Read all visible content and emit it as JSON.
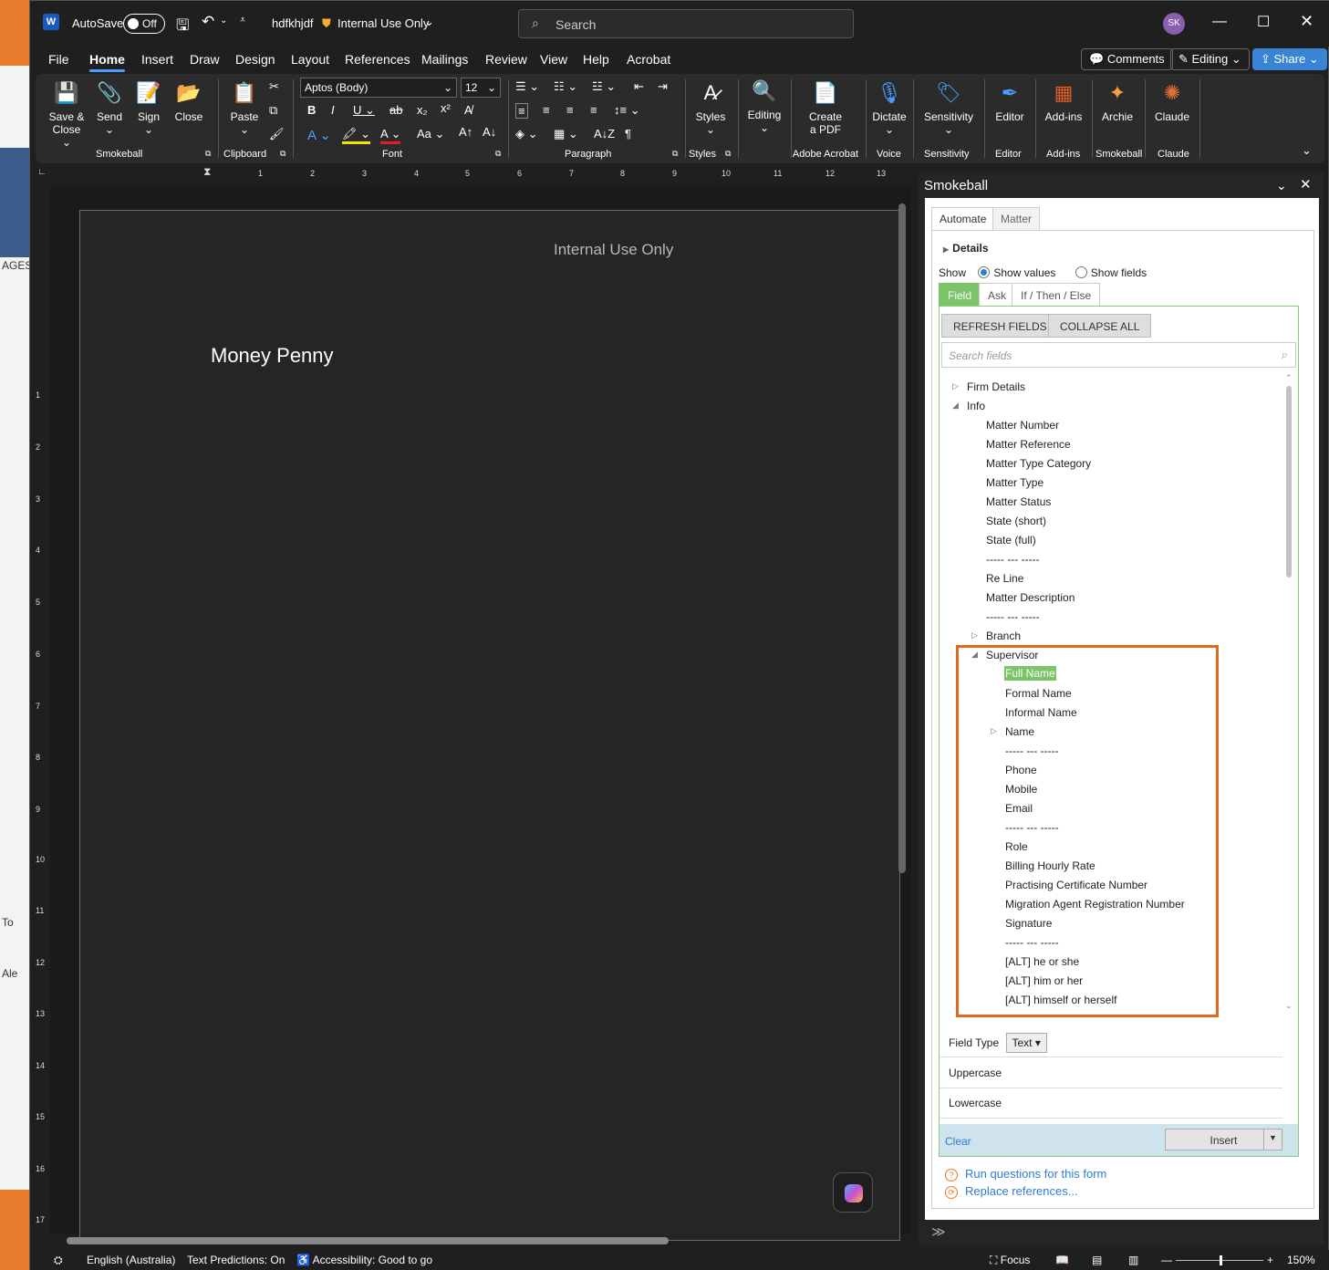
{
  "title_bar": {
    "autosave_label": "AutoSave",
    "autosave_state": "Off",
    "filename": "hdfkhjdf",
    "sensitivity": "Internal Use Only",
    "search_placeholder": "Search",
    "avatar_initials": "SK"
  },
  "menu": {
    "tabs": [
      "File",
      "Home",
      "Insert",
      "Draw",
      "Design",
      "Layout",
      "References",
      "Mailings",
      "Review",
      "View",
      "Help",
      "Acrobat"
    ],
    "active": "Home",
    "comments": "Comments",
    "editing": "Editing",
    "share": "Share"
  },
  "ribbon": {
    "smokeball": {
      "save_close": "Save &",
      "save_close2": "Close",
      "send": "Send",
      "sign": "Sign",
      "close": "Close",
      "group": "Smokeball"
    },
    "clipboard": {
      "paste": "Paste",
      "group": "Clipboard"
    },
    "font": {
      "name": "Aptos (Body)",
      "size": "12",
      "group": "Font"
    },
    "paragraph": {
      "group": "Paragraph"
    },
    "styles": {
      "label": "Styles",
      "group": "Styles"
    },
    "editing": {
      "label": "Editing"
    },
    "acrobat": {
      "label1": "Create",
      "label2": "a PDF",
      "group": "Adobe Acrobat"
    },
    "voice": {
      "label": "Dictate",
      "group": "Voice"
    },
    "sensitivity": {
      "label": "Sensitivity",
      "group": "Sensitivity"
    },
    "editor": {
      "label": "Editor",
      "group": "Editor"
    },
    "addins": {
      "label": "Add-ins",
      "group": "Add-ins"
    },
    "archie": {
      "label": "Archie",
      "group": "Smokeball"
    },
    "claude": {
      "label": "Claude",
      "group": "Claude"
    }
  },
  "ruler": {
    "h": [
      "1",
      "2",
      "3",
      "4",
      "5",
      "6",
      "7",
      "8",
      "9",
      "10",
      "11",
      "12",
      "13"
    ],
    "v": [
      "1",
      "2",
      "3",
      "4",
      "5",
      "6",
      "7",
      "8",
      "9",
      "10",
      "11",
      "12",
      "13",
      "14",
      "15",
      "16",
      "17"
    ]
  },
  "document": {
    "header": "Internal Use Only",
    "body": "Money Penny"
  },
  "background": {
    "ages": "AGES",
    "to": "To",
    "ale": "Ale"
  },
  "pane": {
    "title": "Smokeball",
    "tabs": [
      "Automate",
      "Matter"
    ],
    "details": "Details",
    "show_label": "Show",
    "show_values": "Show values",
    "show_fields": "Show fields",
    "sub_tabs": [
      "Field",
      "Ask",
      "If / Then / Else"
    ],
    "refresh": "REFRESH FIELDS",
    "collapse": "COLLAPSE ALL",
    "search_placeholder": "Search fields",
    "tree": {
      "firm_details": "Firm Details",
      "info": "Info",
      "info_items": [
        "Matter Number",
        "Matter Reference",
        "Matter Type Category",
        "Matter Type",
        "Matter Status",
        "State (short)",
        "State (full)",
        "----- --- -----",
        "Re Line",
        "Matter Description",
        "----- --- -----"
      ],
      "branch": "Branch",
      "supervisor": "Supervisor",
      "supervisor_items": [
        "Full Name",
        "Formal Name",
        "Informal Name",
        "Name",
        "----- --- -----",
        "Phone",
        "Mobile",
        "Email",
        "----- --- -----",
        "Role",
        "Billing Hourly Rate",
        "Practising Certificate Number",
        "Migration Agent Registration Number",
        "Signature",
        "----- --- -----",
        "[ALT] he or she",
        "[ALT] him or her",
        "[ALT] himself or herself"
      ]
    },
    "field_type_label": "Field Type",
    "field_type_value": "Text",
    "options": [
      "Uppercase",
      "Lowercase"
    ],
    "clear": "Clear",
    "insert": "Insert",
    "links": [
      "Run questions for this form",
      "Replace references..."
    ]
  },
  "status_bar": {
    "language": "English (Australia)",
    "predictions": "Text Predictions: On",
    "accessibility": "Accessibility: Good to go",
    "focus": "Focus",
    "zoom": "150%"
  },
  "colors": {
    "accent": "#4a9eff",
    "highlight_box": "#e06a1c",
    "selected": "#7cc46a"
  }
}
